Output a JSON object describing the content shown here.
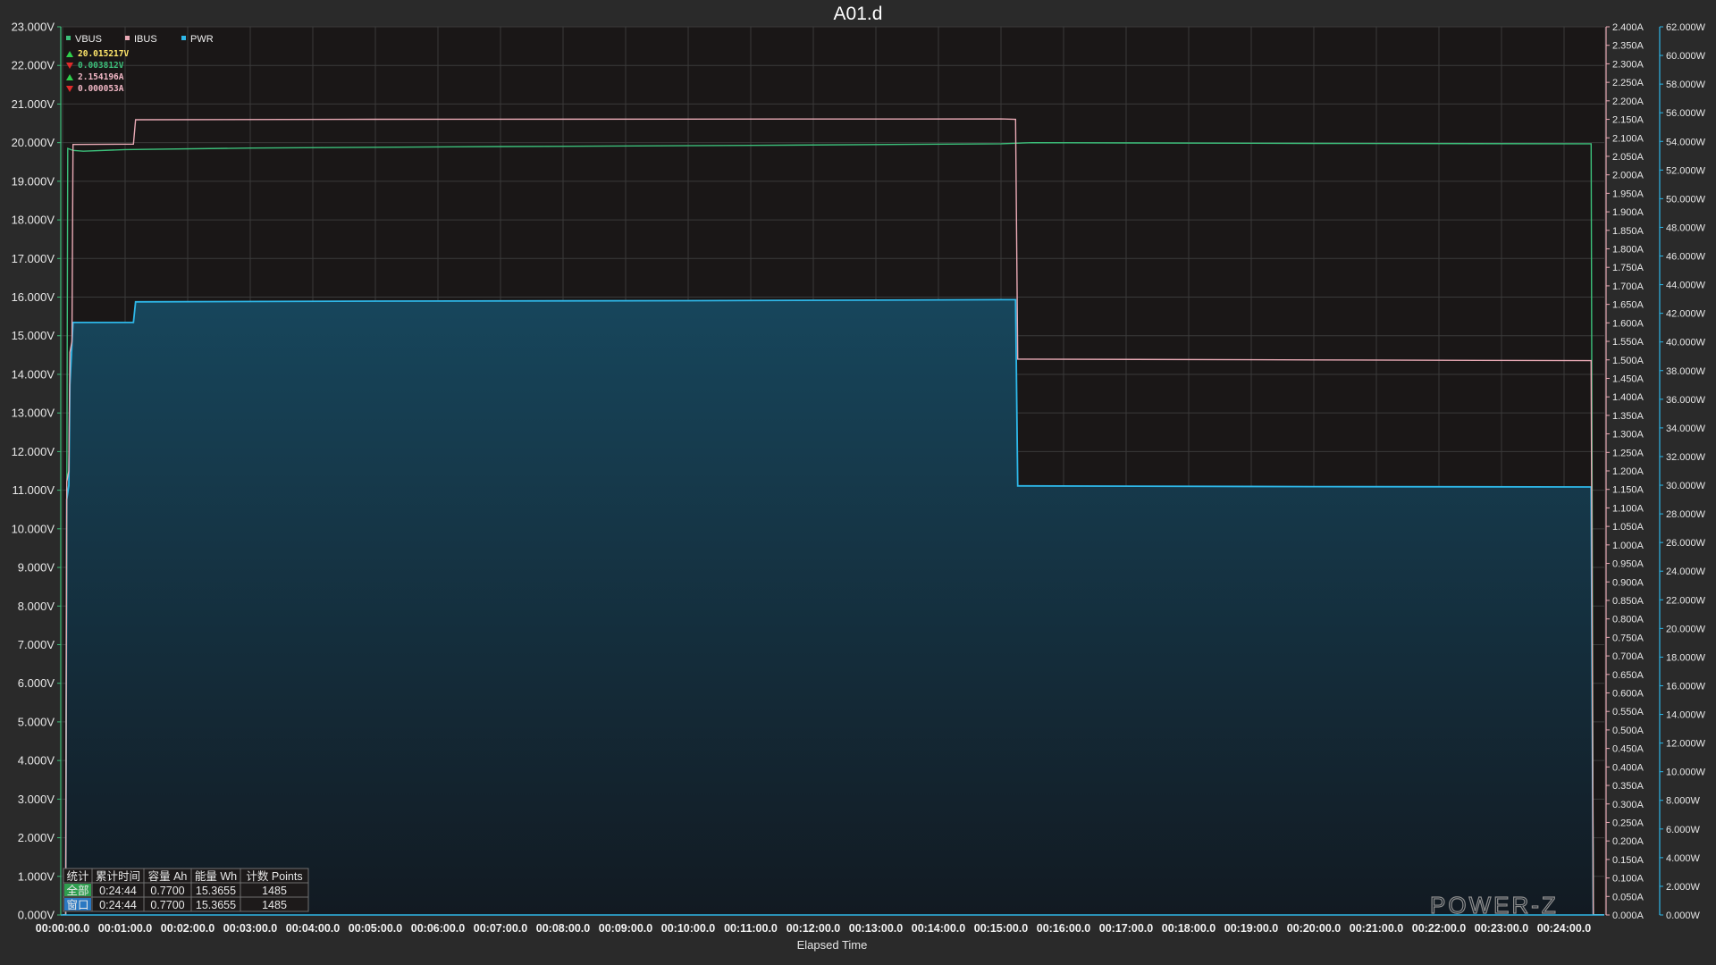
{
  "chart_data": {
    "type": "line",
    "title": "A01.d",
    "xlabel": "Elapsed Time",
    "x_ticks": [
      "00:00:00.0",
      "00:01:00.0",
      "00:02:00.0",
      "00:03:00.0",
      "00:04:00.0",
      "00:05:00.0",
      "00:06:00.0",
      "00:07:00.0",
      "00:08:00.0",
      "00:09:00.0",
      "00:10:00.0",
      "00:11:00.0",
      "00:12:00.0",
      "00:13:00.0",
      "00:14:00.0",
      "00:15:00.0",
      "00:16:00.0",
      "00:17:00.0",
      "00:18:00.0",
      "00:19:00.0",
      "00:20:00.0",
      "00:21:00.0",
      "00:22:00.0",
      "00:23:00.0",
      "00:24:00.0"
    ],
    "x_unit": "seconds",
    "x_range": [
      0,
      1484
    ],
    "axes": {
      "left": {
        "unit": "V",
        "range": [
          0,
          23
        ],
        "step": 1,
        "decimals": 3
      },
      "right1": {
        "unit": "A",
        "range": [
          0,
          2.4
        ],
        "step": 0.05,
        "decimals": 3
      },
      "right2": {
        "unit": "W",
        "range": [
          0,
          62
        ],
        "step": 2,
        "decimals": 3
      }
    },
    "grid": true,
    "legend": {
      "placement": "top-left",
      "entries": [
        "VBUS",
        "IBUS",
        "PWR"
      ]
    },
    "series": [
      {
        "name": "VBUS",
        "axis": "left",
        "color": "#3cbf7a",
        "points": [
          [
            0,
            0
          ],
          [
            3,
            0
          ],
          [
            5,
            19.85
          ],
          [
            10,
            19.8
          ],
          [
            20,
            19.78
          ],
          [
            60,
            19.82
          ],
          [
            180,
            19.86
          ],
          [
            420,
            19.9
          ],
          [
            660,
            19.93
          ],
          [
            900,
            19.97
          ],
          [
            930,
            20.0
          ],
          [
            1200,
            19.98
          ],
          [
            1460,
            19.97
          ],
          [
            1466,
            19.97
          ],
          [
            1468,
            0
          ],
          [
            1484,
            0
          ]
        ]
      },
      {
        "name": "IBUS",
        "axis": "right1",
        "color": "#e8a9b4",
        "points": [
          [
            0,
            0
          ],
          [
            3,
            0
          ],
          [
            4,
            1.17
          ],
          [
            6,
            1.2
          ],
          [
            7,
            1.52
          ],
          [
            9,
            1.55
          ],
          [
            10,
            2.082
          ],
          [
            68,
            2.083
          ],
          [
            70,
            2.149
          ],
          [
            300,
            2.15
          ],
          [
            900,
            2.151
          ],
          [
            914,
            2.15
          ],
          [
            916,
            1.502
          ],
          [
            1200,
            1.5
          ],
          [
            1466,
            1.498
          ],
          [
            1468,
            0
          ],
          [
            1484,
            0
          ]
        ]
      },
      {
        "name": "PWR",
        "axis": "right2",
        "color": "#2eb7e8",
        "fill": "area",
        "points": [
          [
            0,
            0
          ],
          [
            3,
            0
          ],
          [
            4,
            29.0
          ],
          [
            6,
            30.0
          ],
          [
            7,
            37.0
          ],
          [
            10,
            41.36
          ],
          [
            68,
            41.36
          ],
          [
            70,
            42.8
          ],
          [
            300,
            42.85
          ],
          [
            600,
            42.88
          ],
          [
            900,
            42.95
          ],
          [
            914,
            42.95
          ],
          [
            916,
            29.95
          ],
          [
            1200,
            29.9
          ],
          [
            1466,
            29.88
          ],
          [
            1468,
            0
          ],
          [
            1484,
            0
          ]
        ]
      }
    ],
    "readouts": [
      {
        "arrow": "up",
        "value": "20.015217V",
        "color": "#ffe66b"
      },
      {
        "arrow": "down",
        "value": "0.003812V",
        "color": "#3cbf7a"
      },
      {
        "arrow": "up",
        "value": "2.154196A",
        "color": "#f2b8c6"
      },
      {
        "arrow": "down",
        "value": "0.000053A",
        "color": "#f2b8c6"
      }
    ],
    "stats_table": {
      "headers": [
        "统计",
        "累计时间",
        "容量 Ah",
        "能量 Wh",
        "计数 Points"
      ],
      "rows": [
        {
          "label": "全部",
          "label_color": "#2f9e4f",
          "cells": [
            "0:24:44",
            "0.7700",
            "15.3655",
            "1485"
          ]
        },
        {
          "label": "窗口",
          "label_color": "#2a78c2",
          "cells": [
            "0:24:44",
            "0.7700",
            "15.3655",
            "1485"
          ]
        }
      ]
    },
    "watermark": "POWER-Z"
  }
}
